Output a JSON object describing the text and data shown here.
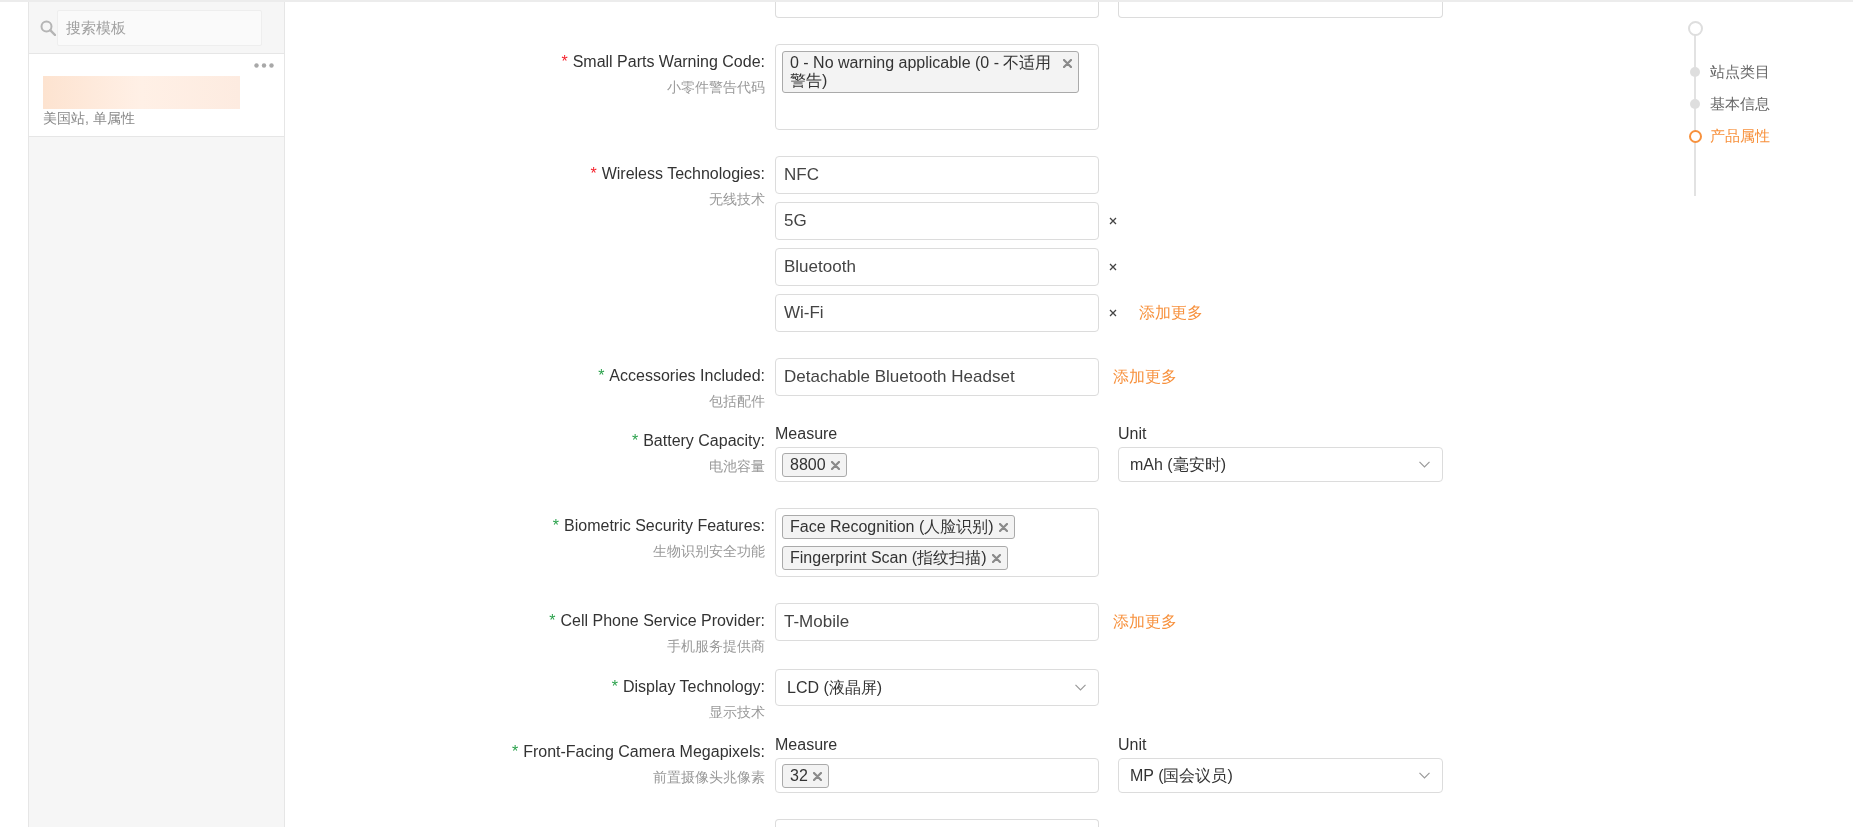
{
  "sidebar": {
    "search": {
      "placeholder": "搜索模板"
    },
    "templates": [
      {
        "subtitle": "美国站, 单属性"
      }
    ]
  },
  "form": {
    "fields": [
      {
        "kind": "tags",
        "required_mark": "*",
        "color": "#f5222d",
        "label": "Small Parts Warning Code:",
        "sublabel": "小零件警告代码",
        "tags": [
          "0 - No warning applicable (0 - 不适用警告)"
        ]
      },
      {
        "kind": "text_list",
        "required_mark": "*",
        "color": "#f5222d",
        "label": "Wireless Technologies:",
        "sublabel": "无线技术",
        "values": [
          {
            "text": "NFC",
            "removable": false
          },
          {
            "text": "5G",
            "removable": true
          },
          {
            "text": "Bluetooth",
            "removable": true
          },
          {
            "text": "Wi-Fi",
            "removable": true
          }
        ],
        "add_more": "添加更多"
      },
      {
        "kind": "text_list",
        "required_mark": "*",
        "color": "#2ba24c",
        "label": "Accessories Included:",
        "sublabel": "包括配件",
        "values": [
          {
            "text": "Detachable Bluetooth Headset",
            "removable": false
          }
        ],
        "add_more": "添加更多"
      },
      {
        "kind": "measure",
        "required_mark": "*",
        "color": "#2ba24c",
        "label": "Battery Capacity:",
        "sublabel": "电池容量",
        "measure_label": "Measure",
        "tags": [
          "8800"
        ],
        "unit_label": "Unit",
        "unit": "mAh (毫安时)"
      },
      {
        "kind": "tags",
        "required_mark": "*",
        "color": "#2ba24c",
        "label": "Biometric Security Features:",
        "sublabel": "生物识别安全功能",
        "tags": [
          "Face Recognition (人脸识别)",
          "Fingerprint Scan (指纹扫描)"
        ]
      },
      {
        "kind": "text_list",
        "required_mark": "*",
        "color": "#2ba24c",
        "label": "Cell Phone Service Provider:",
        "sublabel": "手机服务提供商",
        "values": [
          {
            "text": "T-Mobile",
            "removable": false
          }
        ],
        "add_more": "添加更多"
      },
      {
        "kind": "select",
        "required_mark": "*",
        "color": "#2ba24c",
        "label": "Display Technology:",
        "sublabel": "显示技术",
        "value": "LCD (液晶屏)"
      },
      {
        "kind": "measure",
        "required_mark": "*",
        "color": "#2ba24c",
        "label": "Front-Facing Camera Megapixels:",
        "sublabel": "前置摄像头兆像素",
        "measure_label": "Measure",
        "tags": [
          "32"
        ],
        "unit_label": "Unit",
        "unit": "MP (国会议员)"
      }
    ]
  },
  "steps": [
    {
      "label": "站点类目",
      "selected": false
    },
    {
      "label": "基本信息",
      "selected": false
    },
    {
      "label": "产品属性",
      "selected": true
    }
  ]
}
